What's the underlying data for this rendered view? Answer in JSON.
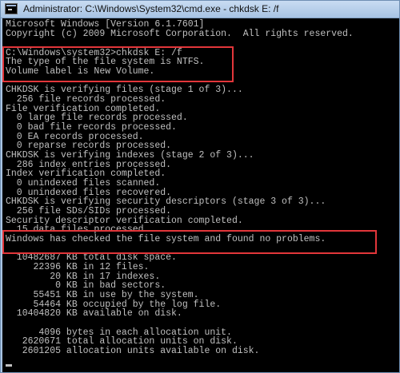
{
  "window": {
    "title": "Administrator: C:\\Windows\\System32\\cmd.exe - chkdsk  E: /f"
  },
  "console": {
    "lines": [
      "Microsoft Windows [Version 6.1.7601]",
      "Copyright (c) 2009 Microsoft Corporation.  All rights reserved.",
      "",
      "C:\\Windows\\system32>chkdsk E: /f",
      "The type of the file system is NTFS.",
      "Volume label is New Volume.",
      "",
      "CHKDSK is verifying files (stage 1 of 3)...",
      "  256 file records processed.",
      "File verification completed.",
      "  0 large file records processed.",
      "  0 bad file records processed.",
      "  0 EA records processed.",
      "  0 reparse records processed.",
      "CHKDSK is verifying indexes (stage 2 of 3)...",
      "  286 index entries processed.",
      "Index verification completed.",
      "  0 unindexed files scanned.",
      "  0 unindexed files recovered.",
      "CHKDSK is verifying security descriptors (stage 3 of 3)...",
      "  256 file SDs/SIDs processed.",
      "Security descriptor verification completed.",
      "  15 data files processed.",
      "Windows has checked the file system and found no problems.",
      "",
      "  10482687 KB total disk space.",
      "     22396 KB in 12 files.",
      "        20 KB in 17 indexes.",
      "         0 KB in bad sectors.",
      "     55451 KB in use by the system.",
      "     54464 KB occupied by the log file.",
      "  10404820 KB available on disk.",
      "",
      "      4096 bytes in each allocation unit.",
      "   2620671 total allocation units on disk.",
      "   2601205 allocation units available on disk."
    ]
  },
  "colors": {
    "console_text": "#c0c0c0",
    "console_background": "#000000",
    "highlight": "#e2363a"
  }
}
